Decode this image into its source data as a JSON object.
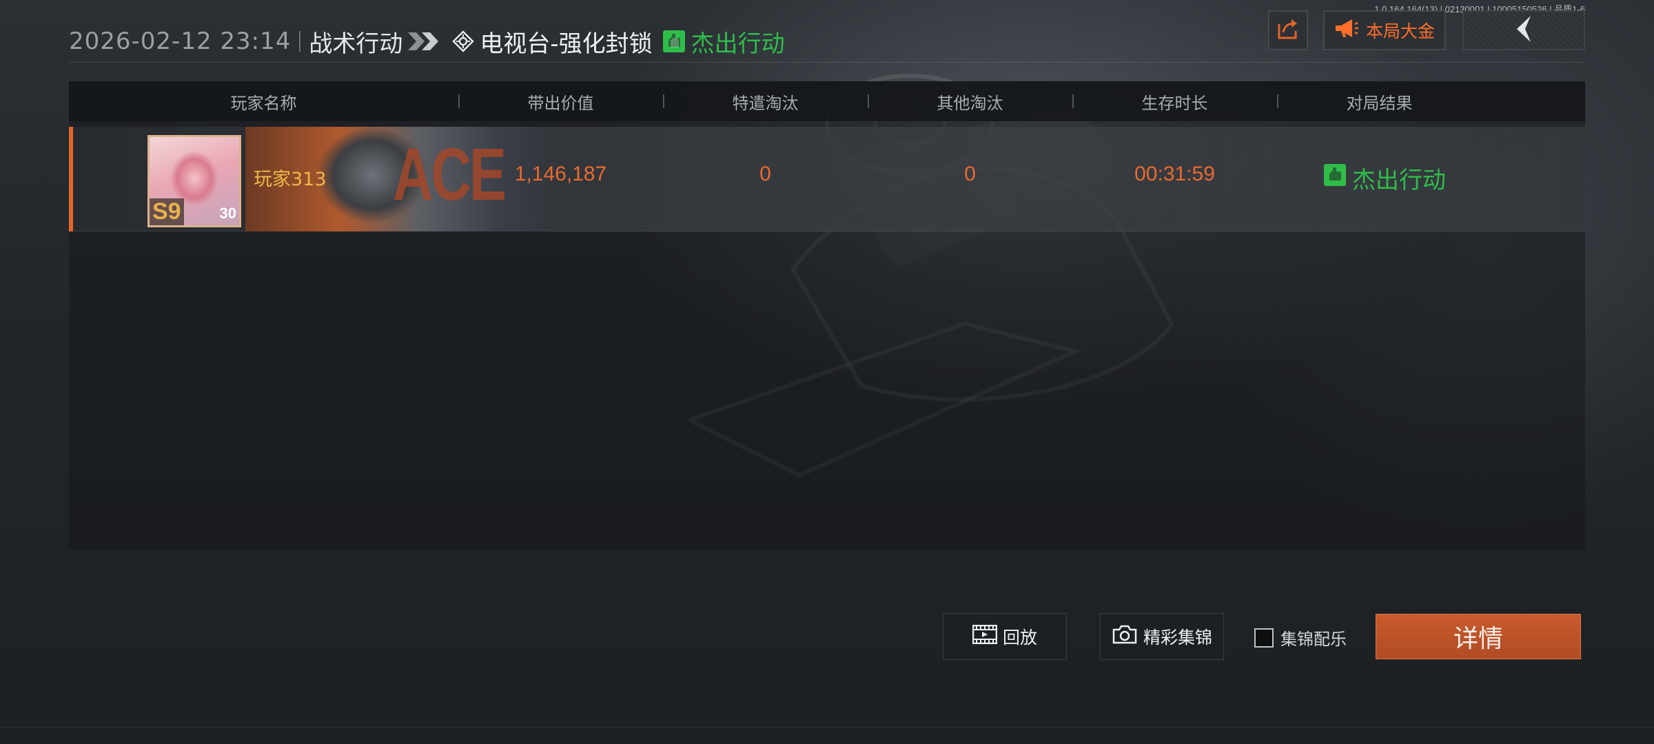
{
  "header": {
    "datetime": "2026-02-12 23:14",
    "mode": "战术行动",
    "map": "电视台-强化封锁",
    "result": "杰出行动"
  },
  "version_info": "1.0.164.164(13) | 02130001 | 10005150526 | 品质1-6",
  "top_buttons": {
    "jackpot_label": "本局大金"
  },
  "table": {
    "columns": [
      "玩家名称",
      "带出价值",
      "特遣淘汰",
      "其他淘汰",
      "生存时长",
      "对局结果"
    ],
    "rows": [
      {
        "player_name": "玩家313",
        "season_badge": "S9",
        "level": "30",
        "card_text": "ACE",
        "value_out": "1,146,187",
        "special_kills": "0",
        "other_kills": "0",
        "survival_time": "00:31:59",
        "result": "杰出行动"
      }
    ]
  },
  "bottom": {
    "replay_label": "回放",
    "highlights_label": "精彩集锦",
    "music_label": "集锦配乐",
    "music_checked": false,
    "detail_label": "详情"
  },
  "colors": {
    "accent_orange": "#e2652a",
    "success_green": "#2fbd4a",
    "value_orange": "#ea6a31",
    "name_gold": "#f2b84a"
  }
}
